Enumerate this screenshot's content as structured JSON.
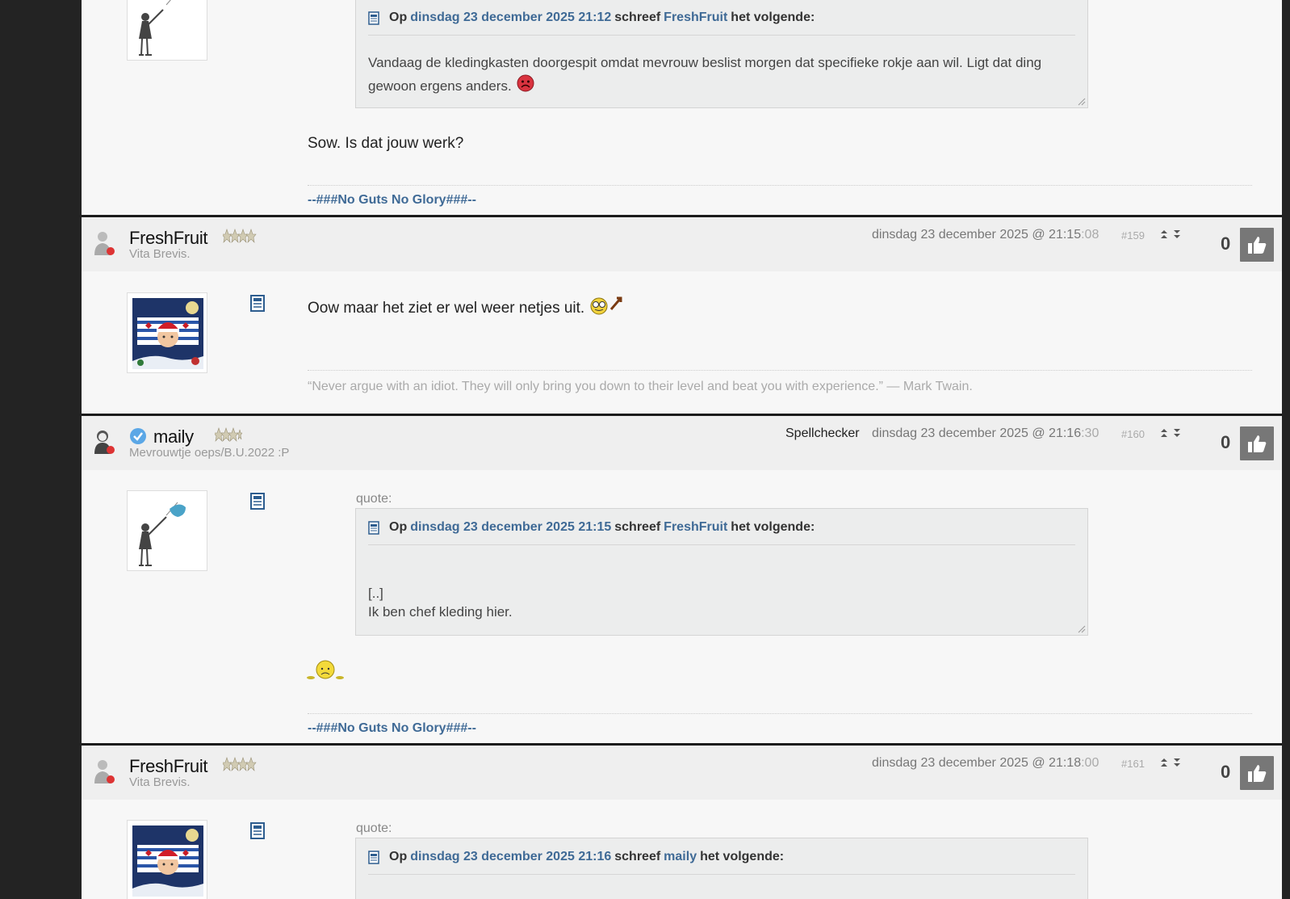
{
  "top_post": {
    "quote_header": {
      "prefix": "Op",
      "date_link": "dinsdag 23 december 2025 21:12",
      "middle": "schreef",
      "user_link": "FreshFruit",
      "suffix": "het volgende:"
    },
    "quote_text": "Vandaag de kledingkasten doorgespit omdat mevrouw beslist morgen dat specifieke rokje aan wil. Ligt dat ding gewoon ergens anders.",
    "body": "Sow. Is dat jouw werk?",
    "signature": "--###No Guts No Glory###--"
  },
  "posts": [
    {
      "username": "FreshFruit",
      "subtitle": "Vita Brevis.",
      "date": "dinsdag 23 december 2025 @ 21:15",
      "seconds": ":08",
      "number": "#159",
      "like_count": "0",
      "body": "Oow maar het ziet er wel weer netjes uit.",
      "signature": "“Never argue with an idiot. They will only bring you down to their level and beat you with experience.” — Mark Twain."
    },
    {
      "username": "maily",
      "subtitle": "Mevrouwtje oeps/B.U.2022 :P",
      "role": "Spellchecker",
      "date": "dinsdag 23 december 2025 @ 21:16",
      "seconds": ":30",
      "number": "#160",
      "like_count": "0",
      "quote_label": "quote:",
      "quote_header": {
        "prefix": "Op",
        "date_link": "dinsdag 23 december 2025 21:15",
        "middle": "schreef",
        "user_link": "FreshFruit",
        "suffix": "het volgende:"
      },
      "quote_line1": "[..]",
      "quote_line2": "Ik ben chef kleding hier.",
      "signature": "--###No Guts No Glory###--"
    },
    {
      "username": "FreshFruit",
      "subtitle": "Vita Brevis.",
      "date": "dinsdag 23 december 2025 @ 21:18",
      "seconds": ":00",
      "number": "#161",
      "like_count": "0",
      "quote_label": "quote:",
      "quote_header": {
        "prefix": "Op",
        "date_link": "dinsdag 23 december 2025 21:16",
        "middle": "schreef",
        "user_link": "maily",
        "suffix": "het volgende:"
      }
    }
  ],
  "colors": {
    "link": "#3f6a96",
    "page_bg": "#f7f7f7",
    "header_bg": "#efefef",
    "side_bg": "#232323"
  }
}
